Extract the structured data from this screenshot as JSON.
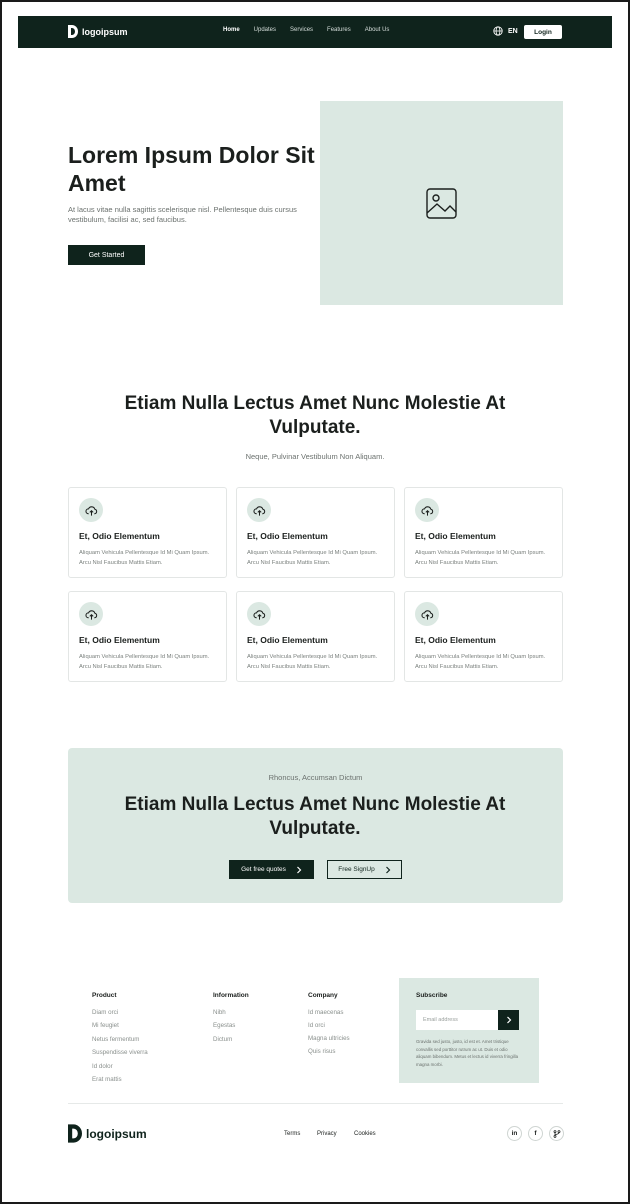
{
  "nav": {
    "logo_text": "logoipsum",
    "links": [
      "Home",
      "Updates",
      "Services",
      "Features",
      "About Us"
    ],
    "lang": "EN",
    "login": "Login"
  },
  "hero": {
    "title": "Lorem Ipsum Dolor Sit Amet",
    "subtitle": "At lacus vitae nulla sagittis scelerisque nisl. Pellentesque duis cursus vestibulum, facilisi ac, sed faucibus.",
    "cta": "Get Started",
    "image_icon": "image-placeholder-icon"
  },
  "features": {
    "title": "Etiam Nulla Lectus Amet Nunc Molestie At Vulputate.",
    "subtitle": "Neque, Pulvinar Vestibulum Non Aliquam.",
    "cards": [
      {
        "title": "Et, Odio Elementum",
        "text": "Aliquam Vehicula Pellentesque Id Mi Quam Ipsum. Arcu Nisl Faucibus Mattis Etiam.",
        "icon": "cloud-upload-icon"
      },
      {
        "title": "Et, Odio Elementum",
        "text": "Aliquam Vehicula Pellentesque Id Mi Quam Ipsum. Arcu Nisl Faucibus Mattis Etiam.",
        "icon": "cloud-upload-icon"
      },
      {
        "title": "Et, Odio Elementum",
        "text": "Aliquam Vehicula Pellentesque Id Mi Quam Ipsum. Arcu Nisl Faucibus Mattis Etiam.",
        "icon": "cloud-upload-icon"
      },
      {
        "title": "Et, Odio Elementum",
        "text": "Aliquam Vehicula Pellentesque Id Mi Quam Ipsum. Arcu Nisl Faucibus Mattis Etiam.",
        "icon": "cloud-upload-icon"
      },
      {
        "title": "Et, Odio Elementum",
        "text": "Aliquam Vehicula Pellentesque Id Mi Quam Ipsum. Arcu Nisl Faucibus Mattis Etiam.",
        "icon": "cloud-upload-icon"
      },
      {
        "title": "Et, Odio Elementum",
        "text": "Aliquam Vehicula Pellentesque Id Mi Quam Ipsum. Arcu Nisl Faucibus Mattis Etiam.",
        "icon": "cloud-upload-icon"
      }
    ]
  },
  "cta": {
    "subtitle": "Rhoncus, Accumsan Dictum",
    "title": "Etiam Nulla Lectus Amet Nunc Molestie At Vulputate.",
    "primary": "Get free quotes",
    "secondary": "Free SignUp"
  },
  "footer": {
    "columns": [
      {
        "title": "Product",
        "links": [
          "Diam orci",
          "Mi feugiet",
          "Netus fermentum",
          "Suspendisse viverra",
          "Id dolor",
          "Erat mattis"
        ]
      },
      {
        "title": "Information",
        "links": [
          "Nibh",
          "Egestas",
          "Dictum"
        ]
      },
      {
        "title": "Company",
        "links": [
          "Id maecenas",
          "Id orci",
          "Magna ultricies",
          "Quis risus"
        ]
      }
    ],
    "subscribe": {
      "title": "Subscribe",
      "placeholder": "Email address",
      "text": "Gravida sed justo, justo, id est et. Amet tristique convallis sed porttitor rutrum ac ut. Duis et odio aliquam bibendum. Metus et lectus id viverra fringilla magna morbi."
    },
    "logo_text": "logoipsum",
    "legal": [
      "Terms",
      "Privacy",
      "Cookies"
    ],
    "social": [
      "in",
      "f",
      "git"
    ]
  },
  "colors": {
    "primary_dark": "#0f231c",
    "mint": "#dbe8e2"
  }
}
